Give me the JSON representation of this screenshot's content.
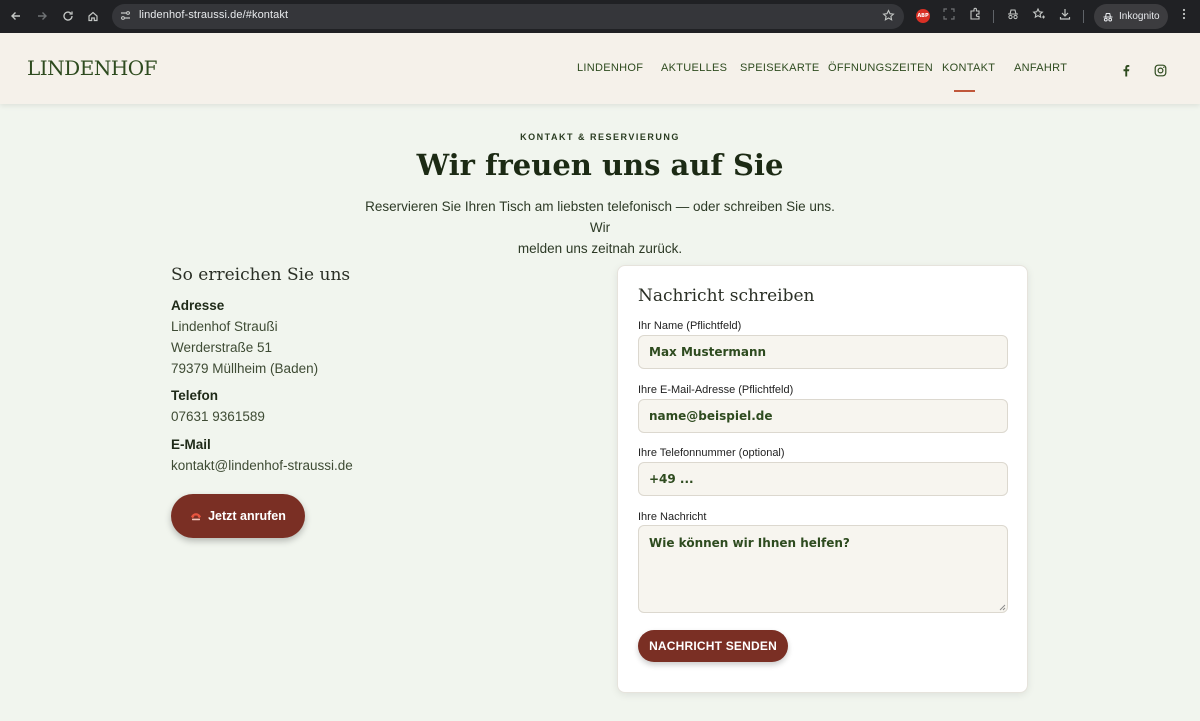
{
  "browser": {
    "url_host": "lindenhof-straussi.de",
    "url_path": "/#kontakt",
    "abp_label": "ABP",
    "incognito_label": "Inkognito"
  },
  "header": {
    "logo": "LINDENHOF",
    "nav": [
      "LINDENHOF",
      "AKTUELLES",
      "SPEISEKARTE",
      "ÖFFNUNGSZEITEN",
      "KONTAKT",
      "ANFAHRT"
    ],
    "active_nav": "KONTAKT",
    "accent_color": "#c0573a"
  },
  "hero": {
    "eyebrow": "KONTAKT & RESERVIERUNG",
    "title": "Wir freuen uns auf Sie",
    "lead_line1": "Reservieren Sie Ihren Tisch am liebsten telefonisch — oder schreiben Sie uns. Wir",
    "lead_line2": "melden uns zeitnah zurück."
  },
  "contact": {
    "heading": "So erreichen Sie uns",
    "address_label": "Adresse",
    "address_lines": [
      "Lindenhof Straußi",
      "Werderstraße 51",
      "79379 Müllheim (Baden)"
    ],
    "phone_label": "Telefon",
    "phone": "07631 9361589",
    "email_label": "E-Mail",
    "email": "kontakt@lindenhof-straussi.de",
    "call_button": "Jetzt anrufen",
    "button_color": "#7a2f24"
  },
  "form": {
    "heading": "Nachricht schreiben",
    "name_label": "Ihr Name (Pflichtfeld)",
    "name_placeholder": "Max Mustermann",
    "email_label": "Ihre E-Mail-Adresse (Pflichtfeld)",
    "email_placeholder": "name@beispiel.de",
    "phone_label": "Ihre Telefonnummer (optional)",
    "phone_placeholder": "+49 ...",
    "message_label": "Ihre Nachricht",
    "message_placeholder": "Wie können wir Ihnen helfen?",
    "submit": "NACHRICHT SENDEN"
  }
}
